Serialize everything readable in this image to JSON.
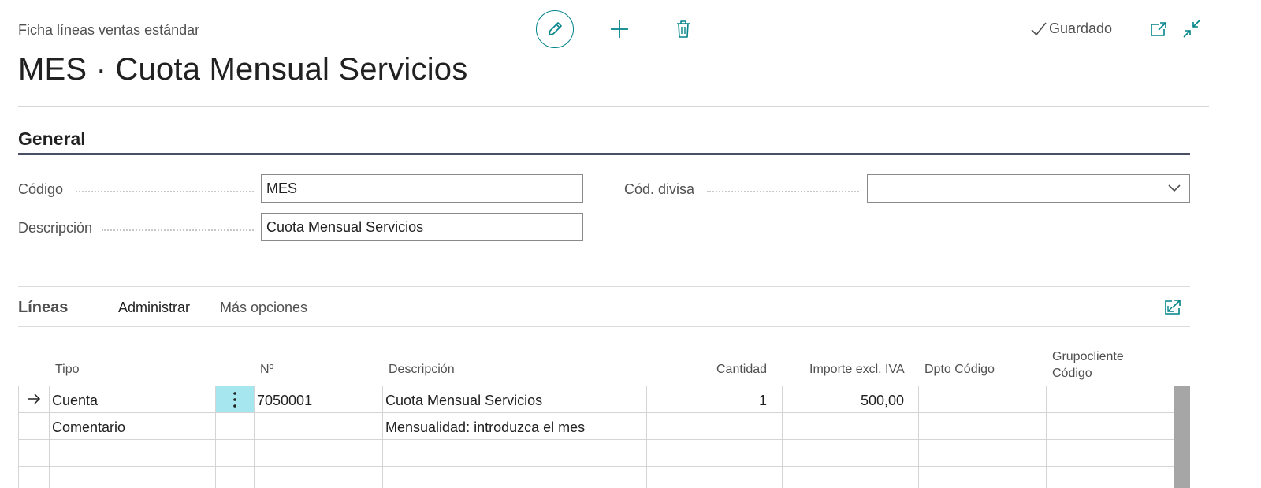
{
  "header": {
    "caption": "Ficha líneas ventas estándar",
    "saved_label": "Guardado",
    "icons": [
      "edit-icon",
      "plus-icon",
      "trash-icon",
      "checkmark-icon",
      "open-new-window-icon",
      "collapse-icon"
    ]
  },
  "title": "MES · Cuota Mensual Servicios",
  "general": {
    "section_title": "General",
    "codigo_label": "Código",
    "codigo_value": "MES",
    "descripcion_label": "Descripción",
    "descripcion_value": "Cuota Mensual Servicios",
    "divisa_label": "Cód. divisa",
    "divisa_value": ""
  },
  "lines": {
    "title": "Líneas",
    "manage_label": "Administrar",
    "more_label": "Más opciones",
    "columns": {
      "tipo": "Tipo",
      "no": "Nº",
      "descripcion": "Descripción",
      "cantidad": "Cantidad",
      "importe": "Importe excl. IVA",
      "dpto": "Dpto Código",
      "grupo_1": "Grupocliente",
      "grupo_2": "Código"
    },
    "rows": [
      {
        "tipo": "Cuenta",
        "no": "7050001",
        "descripcion": "Cuota Mensual Servicios",
        "cantidad": "1",
        "importe": "500,00",
        "dpto": "",
        "grupo": ""
      },
      {
        "tipo": "Comentario",
        "no": "",
        "descripcion": "Mensualidad: introduzca el mes",
        "cantidad": "",
        "importe": "",
        "dpto": "",
        "grupo": ""
      }
    ]
  },
  "colors": {
    "accent": "#008489",
    "selected_cell": "#a6e6ee",
    "section_rule": "#4a5063"
  }
}
